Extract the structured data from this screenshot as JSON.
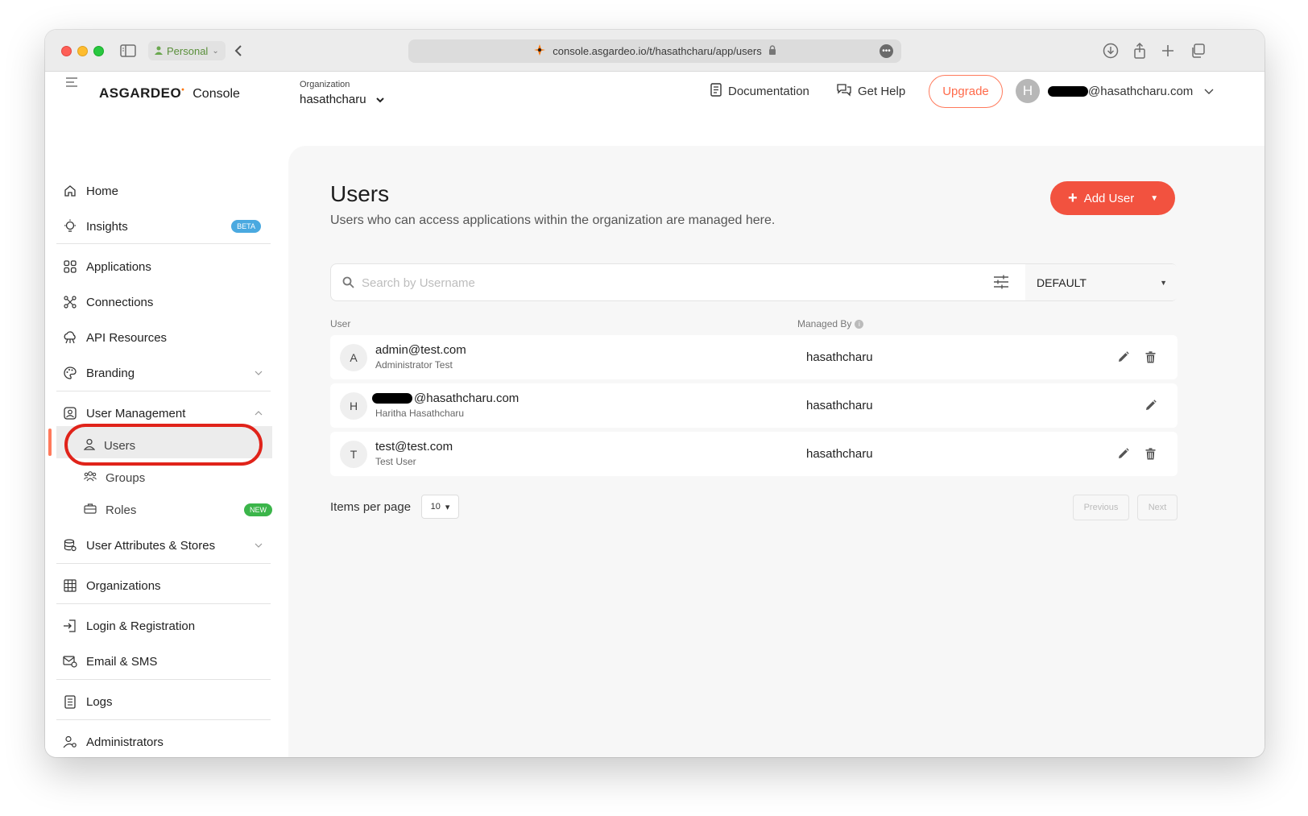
{
  "browser": {
    "profile": "Personal",
    "url": "console.asgardeo.io/t/hasathcharu/app/users"
  },
  "header": {
    "logo": "ASGARDEO",
    "logo_suffix": "Console",
    "org_label": "Organization",
    "org_value": "hasathcharu",
    "documentation": "Documentation",
    "get_help": "Get Help",
    "upgrade": "Upgrade",
    "avatar_initial": "H",
    "user_email_suffix": "@hasathcharu.com"
  },
  "sidebar": {
    "items": [
      {
        "label": "Home",
        "icon": "home-icon"
      },
      {
        "label": "Insights",
        "icon": "lightbulb-icon",
        "badge": "BETA"
      },
      {
        "label": "Applications",
        "icon": "apps-grid-icon"
      },
      {
        "label": "Connections",
        "icon": "connections-icon"
      },
      {
        "label": "API Resources",
        "icon": "api-cloud-icon"
      },
      {
        "label": "Branding",
        "icon": "palette-icon"
      },
      {
        "label": "User Management",
        "icon": "user-management-icon"
      },
      {
        "label": "User Attributes & Stores",
        "icon": "database-icon"
      },
      {
        "label": "Organizations",
        "icon": "building-icon"
      },
      {
        "label": "Login & Registration",
        "icon": "login-icon"
      },
      {
        "label": "Email & SMS",
        "icon": "email-icon"
      },
      {
        "label": "Logs",
        "icon": "document-icon"
      },
      {
        "label": "Administrators",
        "icon": "admin-icon"
      }
    ],
    "sub_items": [
      {
        "label": "Users",
        "icon": "user-icon"
      },
      {
        "label": "Groups",
        "icon": "groups-icon"
      },
      {
        "label": "Roles",
        "icon": "briefcase-icon",
        "badge": "NEW"
      }
    ]
  },
  "main": {
    "title": "Users",
    "subtitle": "Users who can access applications within the organization are managed here.",
    "add_user": "Add User",
    "search_placeholder": "Search by Username",
    "store": "DEFAULT",
    "col_user": "User",
    "col_managed_by": "Managed By",
    "users": [
      {
        "initial": "A",
        "name": "admin@test.com",
        "display": "Administrator Test",
        "managed_by": "hasathcharu",
        "deletable": true
      },
      {
        "initial": "H",
        "name": "@hasathcharu.com",
        "display": "Haritha Hasathcharu",
        "managed_by": "hasathcharu",
        "deletable": false
      },
      {
        "initial": "T",
        "name": "test@test.com",
        "display": "Test User",
        "managed_by": "hasathcharu",
        "deletable": true
      }
    ],
    "items_per_page_label": "Items per page",
    "items_per_page": "10",
    "previous": "Previous",
    "next": "Next"
  },
  "colors": {
    "accent": "#f2523f",
    "upgrade": "#ff6a4a",
    "highlight_ring": "#e0231a",
    "beta_badge": "#4aa9e0",
    "new_badge": "#3bb54a"
  }
}
